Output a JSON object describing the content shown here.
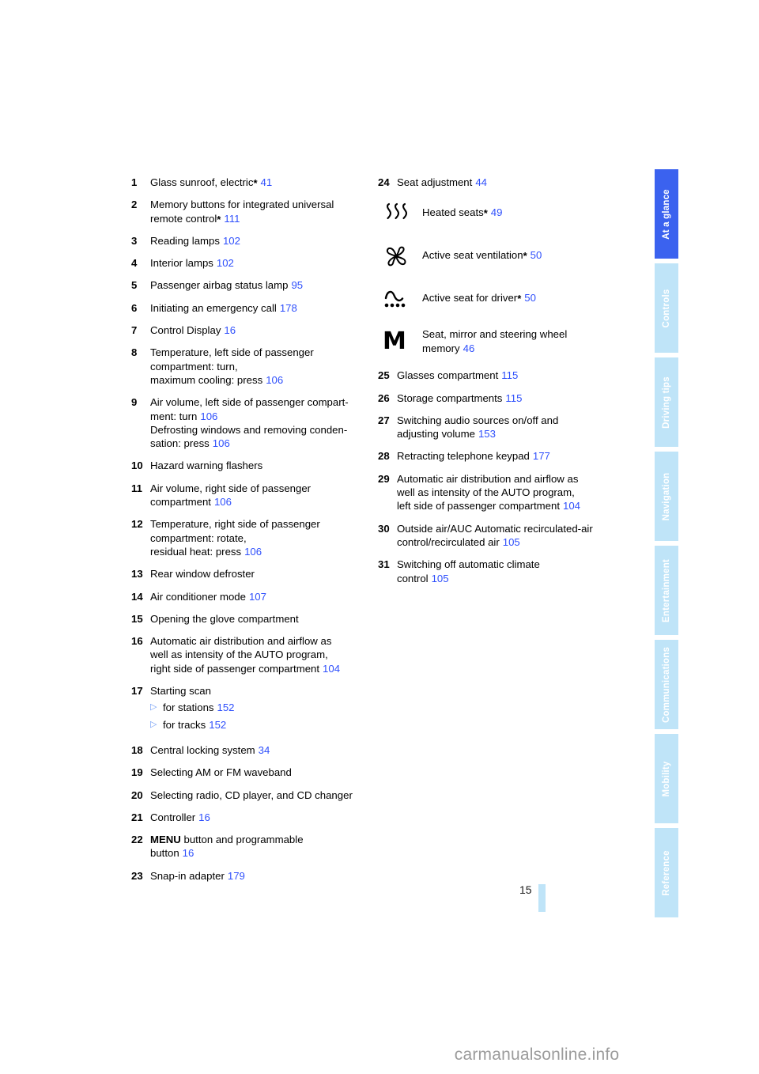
{
  "page": {
    "number": "15",
    "watermark": "carmanualsonline.info"
  },
  "sidebar": {
    "tabs": [
      {
        "label": "At a glance",
        "active": true
      },
      {
        "label": "Controls",
        "active": false
      },
      {
        "label": "Driving tips",
        "active": false
      },
      {
        "label": "Navigation",
        "active": false
      },
      {
        "label": "Entertainment",
        "active": false
      },
      {
        "label": "Communications",
        "active": false
      },
      {
        "label": "Mobility",
        "active": false
      },
      {
        "label": "Reference",
        "active": false
      }
    ]
  },
  "left_column": [
    {
      "num": "1",
      "lines": [
        {
          "text": "Glass sunroof, electric",
          "star": true,
          "ref": "41"
        }
      ]
    },
    {
      "num": "2",
      "lines": [
        {
          "text": "Memory buttons for integrated universal"
        },
        {
          "text": "remote control",
          "star": true,
          "ref": "111"
        }
      ]
    },
    {
      "num": "3",
      "lines": [
        {
          "text": "Reading lamps",
          "ref": "102"
        }
      ]
    },
    {
      "num": "4",
      "lines": [
        {
          "text": "Interior lamps",
          "ref": "102"
        }
      ]
    },
    {
      "num": "5",
      "lines": [
        {
          "text": "Passenger airbag status lamp",
          "ref": "95"
        }
      ]
    },
    {
      "num": "6",
      "lines": [
        {
          "text": "Initiating an emergency call",
          "ref": "178"
        }
      ]
    },
    {
      "num": "7",
      "lines": [
        {
          "text": "Control Display",
          "ref": "16"
        }
      ]
    },
    {
      "num": "8",
      "lines": [
        {
          "text": "Temperature, left side of passenger"
        },
        {
          "text": "compartment: turn,"
        },
        {
          "text": "maximum cooling: press",
          "ref": "106"
        }
      ]
    },
    {
      "num": "9",
      "lines": [
        {
          "text": "Air volume, left side of passenger compart-"
        },
        {
          "text": "ment: turn",
          "ref": "106"
        },
        {
          "text": "Defrosting windows and removing conden-"
        },
        {
          "text": "sation: press",
          "ref": "106"
        }
      ]
    },
    {
      "num": "10",
      "lines": [
        {
          "text": "Hazard warning flashers"
        }
      ]
    },
    {
      "num": "11",
      "lines": [
        {
          "text": "Air volume, right side of passenger"
        },
        {
          "text": "compartment",
          "ref": "106"
        }
      ]
    },
    {
      "num": "12",
      "lines": [
        {
          "text": "Temperature, right side of passenger"
        },
        {
          "text": "compartment: rotate,"
        },
        {
          "text": "residual heat: press",
          "ref": "106"
        }
      ]
    },
    {
      "num": "13",
      "lines": [
        {
          "text": "Rear window defroster"
        }
      ]
    },
    {
      "num": "14",
      "lines": [
        {
          "text": "Air conditioner mode",
          "ref": "107"
        }
      ]
    },
    {
      "num": "15",
      "lines": [
        {
          "text": "Opening the glove compartment"
        }
      ]
    },
    {
      "num": "16",
      "lines": [
        {
          "text": "Automatic air distribution and airflow as"
        },
        {
          "text": "well as intensity of the AUTO program,"
        },
        {
          "text": "right side of passenger compartment",
          "ref": "104"
        }
      ]
    },
    {
      "num": "17",
      "lines": [
        {
          "text": "Starting scan"
        }
      ],
      "subitems": [
        {
          "text": "for stations",
          "ref": "152"
        },
        {
          "text": "for tracks",
          "ref": "152"
        }
      ]
    },
    {
      "num": "18",
      "lines": [
        {
          "text": "Central locking system",
          "ref": "34"
        }
      ]
    },
    {
      "num": "19",
      "lines": [
        {
          "text": "Selecting AM or FM waveband"
        }
      ]
    },
    {
      "num": "20",
      "lines": [
        {
          "text": "Selecting radio, CD player, and CD changer"
        }
      ]
    },
    {
      "num": "21",
      "lines": [
        {
          "text": "Controller",
          "ref": "16"
        }
      ]
    },
    {
      "num": "22",
      "lines": [
        {
          "bold_prefix": "MENU",
          "text": " button and programmable"
        },
        {
          "text": "button",
          "ref": "16"
        }
      ]
    },
    {
      "num": "23",
      "lines": [
        {
          "text": "Snap-in adapter",
          "ref": "179"
        }
      ]
    }
  ],
  "right_column": {
    "item24": {
      "num": "24",
      "text": "Seat adjustment",
      "ref": "44"
    },
    "icon_rows": [
      {
        "icon": "heated-seats-icon",
        "text": "Heated seats",
        "star": true,
        "ref": "49"
      },
      {
        "icon": "seat-ventilation-fan-icon",
        "text": "Active seat ventilation",
        "star": true,
        "ref": "50"
      },
      {
        "icon": "active-seat-wave-icon",
        "text": "Active seat for driver",
        "star": true,
        "ref": "50"
      },
      {
        "icon": "memory-m-icon",
        "glyph": "M",
        "line1": "Seat, mirror and steering wheel",
        "line2": "memory",
        "ref": "46"
      }
    ],
    "items": [
      {
        "num": "25",
        "lines": [
          {
            "text": "Glasses compartment",
            "ref": "115"
          }
        ]
      },
      {
        "num": "26",
        "lines": [
          {
            "text": "Storage compartments",
            "ref": "115"
          }
        ]
      },
      {
        "num": "27",
        "lines": [
          {
            "text": "Switching audio sources on/off and"
          },
          {
            "text": "adjusting volume",
            "ref": "153"
          }
        ]
      },
      {
        "num": "28",
        "lines": [
          {
            "text": "Retracting telephone keypad",
            "ref": "177"
          }
        ]
      },
      {
        "num": "29",
        "lines": [
          {
            "text": "Automatic air distribution and airflow as"
          },
          {
            "text": "well as intensity of the AUTO program,"
          },
          {
            "text": "left side of passenger compartment",
            "ref": "104"
          }
        ]
      },
      {
        "num": "30",
        "lines": [
          {
            "text": "Outside air/AUC Automatic recirculated-air"
          },
          {
            "text": "control/recirculated air",
            "ref": "105"
          }
        ]
      },
      {
        "num": "31",
        "lines": [
          {
            "text": "Switching off automatic climate"
          },
          {
            "text": "control",
            "ref": "105"
          }
        ]
      }
    ]
  },
  "colors": {
    "reference_blue": "#2e4ffc",
    "tab_active": "#3b62ef",
    "tab_inactive": "#bfe4f8"
  }
}
